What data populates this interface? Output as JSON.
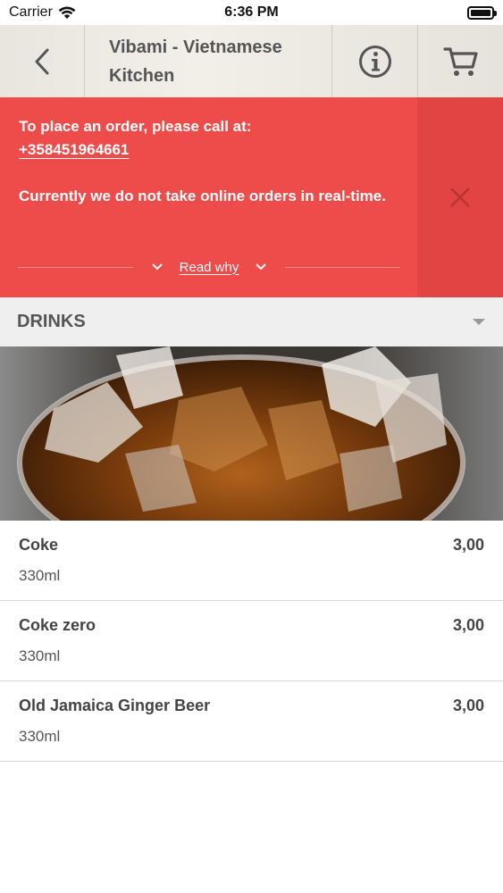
{
  "status_bar": {
    "carrier": "Carrier",
    "time": "6:36 PM"
  },
  "header": {
    "title": "Vibami - Vietnamese Kitchen",
    "icons": [
      "chevron-left-icon",
      "info-icon",
      "shopping-cart-icon"
    ]
  },
  "notice": {
    "line1": "To place an order, please call at:",
    "phone": "+358451964661",
    "line2": "Currently we do not take online orders in real-time.",
    "read_more": "Read why"
  },
  "section": {
    "title": "DRINKS"
  },
  "menu_items": [
    {
      "name": "Coke",
      "description": "330ml",
      "price": "3,00"
    },
    {
      "name": "Coke zero",
      "description": "330ml",
      "price": "3,00"
    },
    {
      "name": "Old Jamaica Ginger Beer",
      "description": "330ml",
      "price": "3,00"
    }
  ],
  "colors": {
    "notice_background": "#ee4b4b",
    "notice_side": "#e24444",
    "section_background": "#efefef",
    "header_icon": "#555555"
  }
}
